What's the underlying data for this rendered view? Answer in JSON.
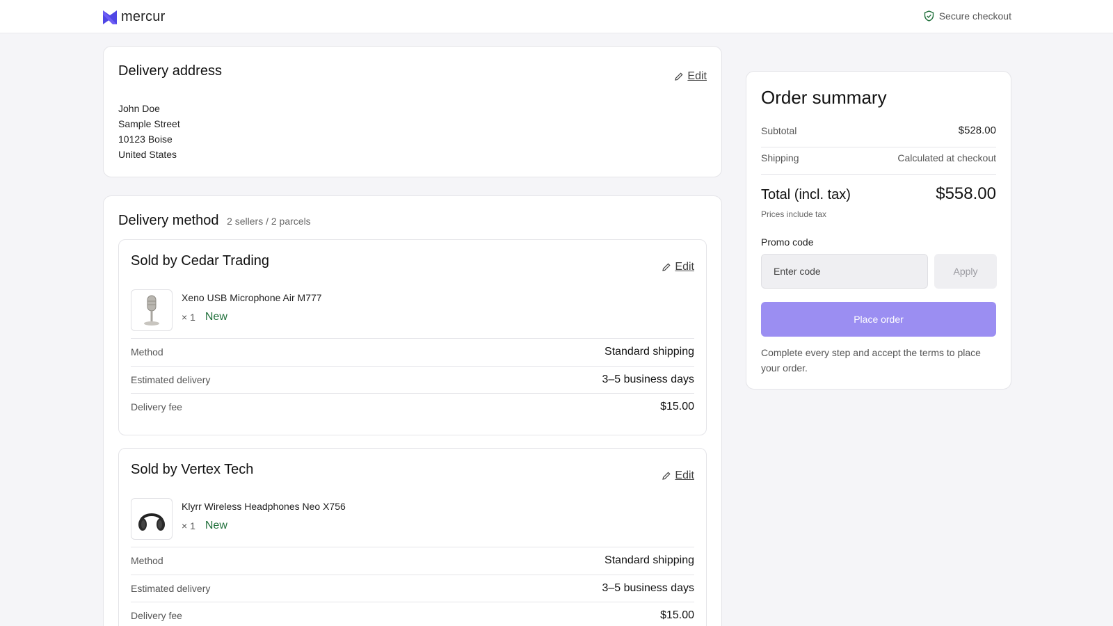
{
  "header": {
    "brand": "mercur",
    "secure_label": "Secure checkout",
    "brand_color": "#4f46e5",
    "secure_icon_color": "#1f6f3a"
  },
  "address": {
    "title": "Delivery address",
    "edit_label": "Edit",
    "lines": [
      "John Doe",
      "Sample Street",
      "10123 Boise",
      "United States"
    ]
  },
  "delivery": {
    "title": "Delivery method",
    "subtitle": "2 sellers / 2 parcels",
    "sellers": [
      {
        "title": "Sold by Cedar Trading",
        "edit_label": "Edit",
        "product": {
          "name": "Xeno USB Microphone Air M777",
          "qty": "× 1",
          "condition": "New",
          "icon": "microphone-icon"
        },
        "rows": [
          {
            "label": "Method",
            "value": "Standard shipping"
          },
          {
            "label": "Estimated delivery",
            "value": "3–5 business days"
          },
          {
            "label": "Delivery fee",
            "value": "$15.00"
          }
        ]
      },
      {
        "title": "Sold by Vertex Tech",
        "edit_label": "Edit",
        "product": {
          "name": "Klyrr Wireless Headphones Neo X756",
          "qty": "× 1",
          "condition": "New",
          "icon": "headphones-icon"
        },
        "rows": [
          {
            "label": "Method",
            "value": "Standard shipping"
          },
          {
            "label": "Estimated delivery",
            "value": "3–5 business days"
          },
          {
            "label": "Delivery fee",
            "value": "$15.00"
          }
        ]
      }
    ]
  },
  "summary": {
    "title": "Order summary",
    "subtotal_label": "Subtotal",
    "subtotal_value": "$528.00",
    "shipping_label": "Shipping",
    "shipping_value": "Calculated at checkout",
    "total_label": "Total (incl. tax)",
    "total_value": "$558.00",
    "tax_note": "Prices include tax",
    "promo_label": "Promo code",
    "promo_placeholder": "Enter code",
    "apply_label": "Apply",
    "place_order_label": "Place order",
    "hint": "Complete every step and accept the terms to place your order.",
    "accent_color": "#9b8ef2"
  }
}
